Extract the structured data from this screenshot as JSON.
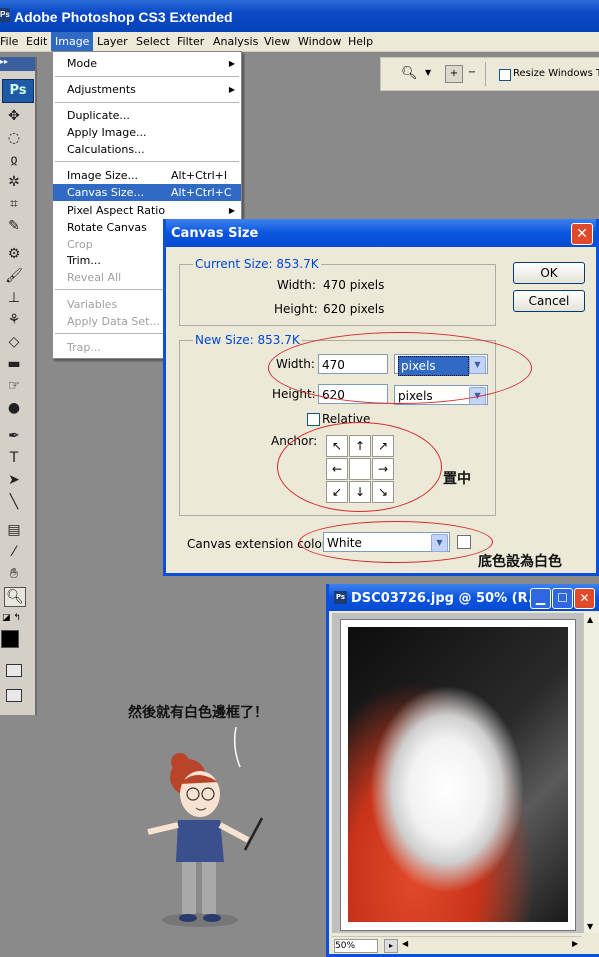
{
  "app": {
    "title": "Adobe Photoshop CS3 Extended",
    "logo": "Ps",
    "menus": [
      "File",
      "Edit",
      "Image",
      "Layer",
      "Select",
      "Filter",
      "Analysis",
      "View",
      "Window",
      "Help"
    ],
    "active_menu": "Image"
  },
  "options_bar": {
    "resize_label": "Resize Windows To"
  },
  "image_menu": {
    "items": [
      {
        "label": "Mode",
        "submenu": true
      },
      {
        "label": "Adjustments",
        "submenu": true
      },
      {
        "label": "Duplicate..."
      },
      {
        "label": "Apply Image..."
      },
      {
        "label": "Calculations..."
      },
      {
        "label": "Image Size...",
        "shortcut": "Alt+Ctrl+I"
      },
      {
        "label": "Canvas Size...",
        "shortcut": "Alt+Ctrl+C",
        "highlighted": true
      },
      {
        "label": "Pixel Aspect Ratio",
        "submenu": true
      },
      {
        "label": "Rotate Canvas",
        "submenu": true
      },
      {
        "label": "Crop",
        "disabled": true
      },
      {
        "label": "Trim..."
      },
      {
        "label": "Reveal All",
        "disabled": true
      },
      {
        "label": "Variables",
        "submenu": true,
        "disabled": true
      },
      {
        "label": "Apply Data Set...",
        "disabled": true
      },
      {
        "label": "Trap...",
        "disabled": true
      }
    ]
  },
  "canvas_dialog": {
    "title": "Canvas Size",
    "current_size_label": "Current Size: 853.7K",
    "current_width_label": "Width:",
    "current_width_value": "470 pixels",
    "current_height_label": "Height:",
    "current_height_value": "620 pixels",
    "new_size_label": "New Size: 853.7K",
    "width_label": "Width:",
    "width_value": "470",
    "width_unit": "pixels",
    "height_label": "Height:",
    "height_value": "620",
    "height_unit": "pixels",
    "relative_label": "Relative",
    "anchor_label": "Anchor:",
    "ext_color_label": "Canvas extension color:",
    "ext_color_value": "White",
    "ok_label": "OK",
    "cancel_label": "Cancel"
  },
  "annotations": {
    "center_note": "置中",
    "bg_note": "底色設為白色",
    "speech": "然後就有白色邊框了！"
  },
  "photo_window": {
    "title": "DSC03726.jpg @ 50% (R...",
    "zoom": "50%"
  }
}
